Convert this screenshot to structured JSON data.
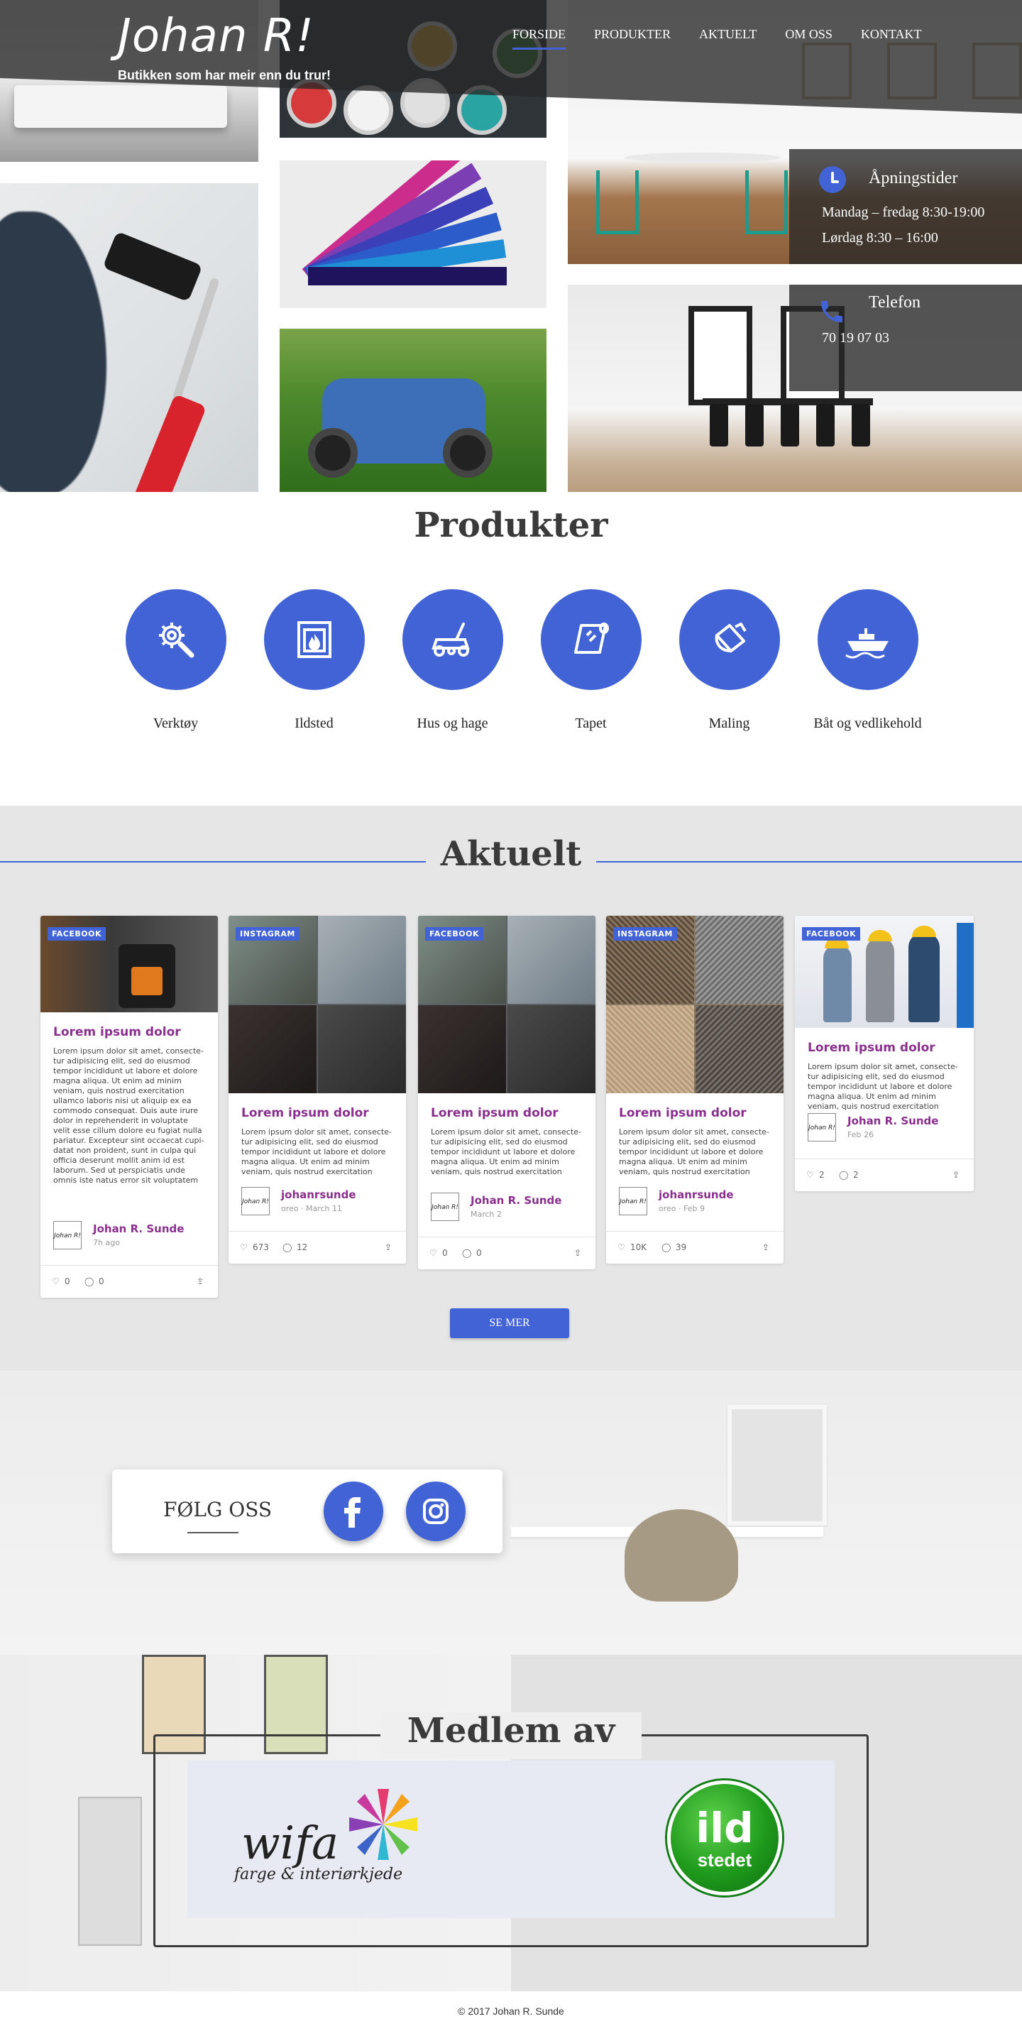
{
  "header": {
    "logo": "Johan R!",
    "tagline": "Butikken som har meir enn du trur!",
    "nav": [
      "FORSIDE",
      "PRODUKTER",
      "AKTUELT",
      "OM OSS",
      "KONTAKT"
    ],
    "active_nav": "FORSIDE"
  },
  "hours": {
    "title": "Åpningstider",
    "line1": "Mandag – fredag 8:30-19:00",
    "line2": "Lørdag 8:30 – 16:00"
  },
  "phone": {
    "title": "Telefon",
    "number": "70 19 07 03"
  },
  "produkter": {
    "title": "Produkter",
    "items": [
      {
        "label": "Verktøy",
        "icon": "tools-icon"
      },
      {
        "label": "Ildsted",
        "icon": "fireplace-icon"
      },
      {
        "label": "Hus og hage",
        "icon": "lawnmower-icon"
      },
      {
        "label": "Tapet",
        "icon": "wallpaper-icon"
      },
      {
        "label": "Maling",
        "icon": "paint-bucket-icon"
      },
      {
        "label": "Båt og vedlikehold",
        "icon": "boat-icon"
      }
    ]
  },
  "aktuelt": {
    "title": "Aktuelt",
    "button": "SE MER",
    "posts": [
      {
        "source": "FACEBOOK",
        "title": "Lorem ipsum dolor",
        "text": "Lorem ipsum dolor sit amet, consecte-tur adipisicing elit, sed do eiusmod tempor incididunt ut labore et dolore magna aliqua. Ut enim ad minim veniam, quis nostrud exercitation ullamco laboris nisi ut aliquip ex ea commodo consequat. Duis aute irure dolor in reprehenderit in voluptate velit esse cillum dolore eu fugiat nulla pariatur. Excepteur sint occaecat cupi-datat non proident, sunt in culpa qui officia deserunt mollit anim id est laborum. Sed ut perspiciatis unde omnis iste natus error sit voluptatem",
        "author": "Johan R. Sunde",
        "date": "7h ago",
        "likes": "0",
        "comments": "0"
      },
      {
        "source": "INSTAGRAM",
        "title": "Lorem ipsum dolor",
        "text": "Lorem ipsum dolor sit amet, consecte-tur adipisicing elit, sed do eiusmod tempor incididunt ut labore et dolore magna aliqua. Ut enim ad minim veniam, quis nostrud exercitation",
        "author": "johanrsunde",
        "date": "oreo · March 11",
        "likes": "673",
        "comments": "12"
      },
      {
        "source": "FACEBOOK",
        "title": "Lorem ipsum dolor",
        "text": "Lorem ipsum dolor sit amet, consecte-tur adipisicing elit, sed do eiusmod tempor incididunt ut labore et dolore magna aliqua. Ut enim ad minim veniam, quis nostrud exercitation",
        "author": "Johan R. Sunde",
        "date": "March 2",
        "likes": "0",
        "comments": "0"
      },
      {
        "source": "INSTAGRAM",
        "title": "Lorem ipsum dolor",
        "text": "Lorem ipsum dolor sit amet, consecte-tur adipisicing elit, sed do eiusmod tempor incididunt ut labore et dolore magna aliqua. Ut enim ad minim veniam, quis nostrud exercitation",
        "author": "johanrsunde",
        "date": "oreo · Feb 9",
        "likes": "10K",
        "comments": "39"
      },
      {
        "source": "FACEBOOK",
        "title": "Lorem ipsum dolor",
        "text": "Lorem ipsum dolor sit amet, consecte-tur adipisicing elit, sed do eiusmod tempor incididunt ut labore et dolore magna aliqua. Ut enim ad minim veniam, quis nostrud exercitation",
        "author": "Johan R. Sunde",
        "date": "Feb 26",
        "likes": "2",
        "comments": "2"
      }
    ],
    "author_logo": "Johan R!"
  },
  "follow": {
    "title": "FØLG OSS",
    "facebook_icon": "facebook-icon",
    "instagram_icon": "instagram-icon"
  },
  "medlem": {
    "title": "Medlem av",
    "wifa_name": "wifa",
    "wifa_sub": "farge & interiørkjede",
    "ild_top": "ild",
    "ild_bottom": "stedet"
  },
  "footer": {
    "copyright": "© 2017 Johan R. Sunde"
  },
  "colors": {
    "accent": "#4263d6",
    "post_title": "#8a2f8e"
  }
}
